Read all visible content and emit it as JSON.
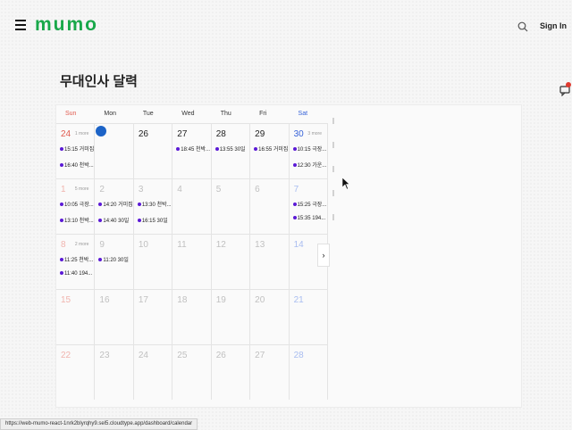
{
  "header": {
    "logo": "mumo",
    "menu_icon": "hamburger-icon",
    "search_icon": "search-icon",
    "sign_in": "Sign In"
  },
  "page": {
    "title": "무대인사 달력"
  },
  "chat": {
    "icon": "chat-icon",
    "badge_color": "#e03a2f"
  },
  "calendar": {
    "weekdays": [
      "Sun",
      "Mon",
      "Tue",
      "Wed",
      "Thu",
      "Fri",
      "Sat"
    ],
    "colors": {
      "sun": "#e05a4e",
      "sat": "#3561d8",
      "event_dot": "#5b1ad6",
      "today": "#1c63c7"
    },
    "weeks": [
      [
        {
          "day": "24",
          "faded": false,
          "more": "1 more",
          "events": [
            "15:15 거미집",
            "16:40 천박..."
          ]
        },
        {
          "day": "25",
          "today": true,
          "events": []
        },
        {
          "day": "26",
          "events": []
        },
        {
          "day": "27",
          "events": [
            "18:45 천박..."
          ]
        },
        {
          "day": "28",
          "events": [
            "13:55 30일"
          ]
        },
        {
          "day": "29",
          "events": [
            "16:55 거미집"
          ]
        },
        {
          "day": "30",
          "more": "3 more",
          "events": [
            "10:15 극장...",
            "12:30 가운..."
          ]
        }
      ],
      [
        {
          "day": "1",
          "faded": true,
          "more": "5 more",
          "events": [
            "10:05 극장...",
            "13:10 천박..."
          ]
        },
        {
          "day": "2",
          "faded": true,
          "events": [
            "14:20 거미집",
            "14:40 30일"
          ]
        },
        {
          "day": "3",
          "faded": true,
          "events": [
            "13:30 천박...",
            "16:15 30일"
          ]
        },
        {
          "day": "4",
          "faded": true,
          "events": []
        },
        {
          "day": "5",
          "faded": true,
          "events": []
        },
        {
          "day": "6",
          "faded": true,
          "events": []
        },
        {
          "day": "7",
          "faded": true,
          "events": [
            "15:25 극장...",
            "15:35 194..."
          ]
        }
      ],
      [
        {
          "day": "8",
          "faded": true,
          "more": "2 more",
          "events": [
            "11:25 천박...",
            "11:40 194..."
          ]
        },
        {
          "day": "9",
          "faded": true,
          "events": [
            "11:20 30일"
          ]
        },
        {
          "day": "10",
          "faded": true,
          "events": []
        },
        {
          "day": "11",
          "faded": true,
          "events": []
        },
        {
          "day": "12",
          "faded": true,
          "events": []
        },
        {
          "day": "13",
          "faded": true,
          "events": []
        },
        {
          "day": "14",
          "faded": true,
          "events": []
        }
      ],
      [
        {
          "day": "15",
          "faded": true,
          "events": []
        },
        {
          "day": "16",
          "faded": true,
          "events": []
        },
        {
          "day": "17",
          "faded": true,
          "events": []
        },
        {
          "day": "18",
          "faded": true,
          "events": []
        },
        {
          "day": "19",
          "faded": true,
          "events": []
        },
        {
          "day": "20",
          "faded": true,
          "events": []
        },
        {
          "day": "21",
          "faded": true,
          "events": []
        }
      ],
      [
        {
          "day": "22",
          "faded": true,
          "events": []
        },
        {
          "day": "23",
          "faded": true,
          "events": []
        },
        {
          "day": "24",
          "faded": true,
          "events": []
        },
        {
          "day": "25",
          "faded": true,
          "events": []
        },
        {
          "day": "26",
          "faded": true,
          "events": []
        },
        {
          "day": "27",
          "faded": true,
          "events": []
        },
        {
          "day": "28",
          "faded": true,
          "events": []
        }
      ]
    ],
    "next_button": "›"
  },
  "status_bar": "https://web-mumo-react-1nrk2blyrqhy9.sel5.cloudtype.app/dashboard/calendar"
}
